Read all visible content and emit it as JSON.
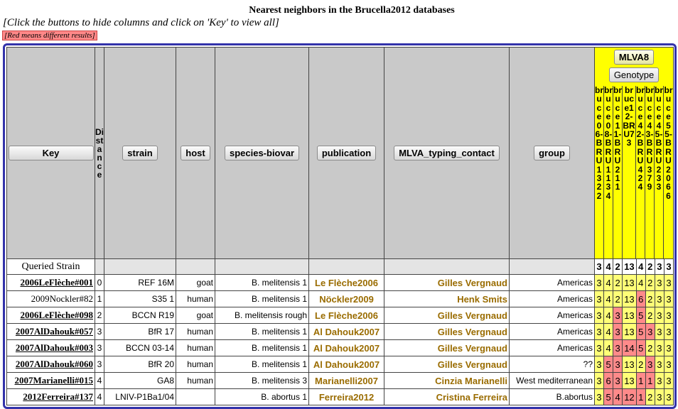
{
  "page": {
    "title": "Nearest neighbors in the Brucella2012 databases",
    "hint": "[Click the buttons to hide columns and click on 'Key' to view all]",
    "red_legend": "[Red means different results]"
  },
  "columns": {
    "key": "Key",
    "distance": "Distance",
    "strain": "strain",
    "host": "host",
    "species_biovar": "species-biovar",
    "publication": "publication",
    "contact": "MLVA_typing_contact",
    "group": "group",
    "panel_button": "MLVA8",
    "genotype_button": "Genotype"
  },
  "markers": [
    "bruce06-BRU1322",
    "bruce08-BRU1134",
    "bruce11-BRU211",
    "bruce12-BRU73",
    "bruce42-BRU424",
    "bruce43-BRU379",
    "bruce45-BRU233",
    "bruce55-BRU2066"
  ],
  "queried": {
    "label": "Queried Strain",
    "values": [
      "3",
      "4",
      "2",
      "13",
      "4",
      "2",
      "3",
      "3"
    ]
  },
  "rows": [
    {
      "key": "2006LeFlèche#001",
      "key_link": true,
      "distance": "0",
      "strain": "REF 16M",
      "host": "goat",
      "species": "B. melitensis 1",
      "publication": "Le Flèche2006",
      "contact": "Gilles Vergnaud",
      "group": "Americas",
      "values": [
        "3",
        "4",
        "2",
        "13",
        "4",
        "2",
        "3",
        "3"
      ],
      "diff": [
        false,
        false,
        false,
        false,
        false,
        false,
        false,
        false
      ]
    },
    {
      "key": "2009Nockler#82",
      "key_link": false,
      "distance": "1",
      "strain": "S35 1",
      "host": "human",
      "species": "B. melitensis 1",
      "publication": "Nöckler2009",
      "contact": "Henk Smits",
      "group": "Americas",
      "values": [
        "3",
        "4",
        "2",
        "13",
        "6",
        "2",
        "3",
        "3"
      ],
      "diff": [
        false,
        false,
        false,
        false,
        true,
        false,
        false,
        false
      ]
    },
    {
      "key": "2006LeFlèche#098",
      "key_link": true,
      "distance": "2",
      "strain": "BCCN R19",
      "host": "goat",
      "species": "B. melitensis rough",
      "publication": "Le Flèche2006",
      "contact": "Gilles Vergnaud",
      "group": "Americas",
      "values": [
        "3",
        "4",
        "3",
        "13",
        "5",
        "2",
        "3",
        "3"
      ],
      "diff": [
        false,
        false,
        true,
        false,
        true,
        false,
        false,
        false
      ]
    },
    {
      "key": "2007AlDahouk#057",
      "key_link": true,
      "distance": "3",
      "strain": "BfR 17",
      "host": "human",
      "species": "B. melitensis 1",
      "publication": "Al Dahouk2007",
      "contact": "Gilles Vergnaud",
      "group": "Americas",
      "values": [
        "3",
        "4",
        "3",
        "13",
        "5",
        "3",
        "3",
        "3"
      ],
      "diff": [
        false,
        false,
        true,
        false,
        true,
        true,
        false,
        false
      ]
    },
    {
      "key": "2007AlDahouk#003",
      "key_link": true,
      "distance": "3",
      "strain": "BCCN 03-14",
      "host": "human",
      "species": "B. melitensis 1",
      "publication": "Al Dahouk2007",
      "contact": "Gilles Vergnaud",
      "group": "Americas",
      "values": [
        "3",
        "4",
        "3",
        "14",
        "5",
        "2",
        "3",
        "3"
      ],
      "diff": [
        false,
        false,
        true,
        true,
        true,
        false,
        false,
        false
      ]
    },
    {
      "key": "2007AlDahouk#060",
      "key_link": true,
      "distance": "3",
      "strain": "BfR 20",
      "host": "human",
      "species": "B. melitensis 1",
      "publication": "Al Dahouk2007",
      "contact": "Gilles Vergnaud",
      "group": "??",
      "values": [
        "3",
        "5",
        "3",
        "13",
        "2",
        "3",
        "3",
        "3"
      ],
      "diff": [
        false,
        true,
        true,
        false,
        false,
        true,
        false,
        false
      ]
    },
    {
      "key": "2007Marianelli#015",
      "key_link": true,
      "distance": "4",
      "strain": "GA8",
      "host": "human",
      "species": "B. melitensis 3",
      "publication": "Marianelli2007",
      "contact": "Cinzia Marianelli",
      "group": "West mediterranean",
      "values": [
        "3",
        "6",
        "3",
        "13",
        "1",
        "1",
        "3",
        "3"
      ],
      "diff": [
        false,
        true,
        true,
        false,
        true,
        true,
        false,
        false
      ]
    },
    {
      "key": "2012Ferreira#137",
      "key_link": true,
      "distance": "4",
      "strain": "LNIV-P1Ba1/04",
      "host": "",
      "species": "B. abortus 1",
      "publication": "Ferreira2012",
      "contact": "Cristina Ferreira",
      "group": "B.abortus",
      "values": [
        "3",
        "5",
        "4",
        "12",
        "1",
        "2",
        "3",
        "3"
      ],
      "diff": [
        false,
        true,
        true,
        true,
        true,
        false,
        false,
        false
      ]
    }
  ]
}
